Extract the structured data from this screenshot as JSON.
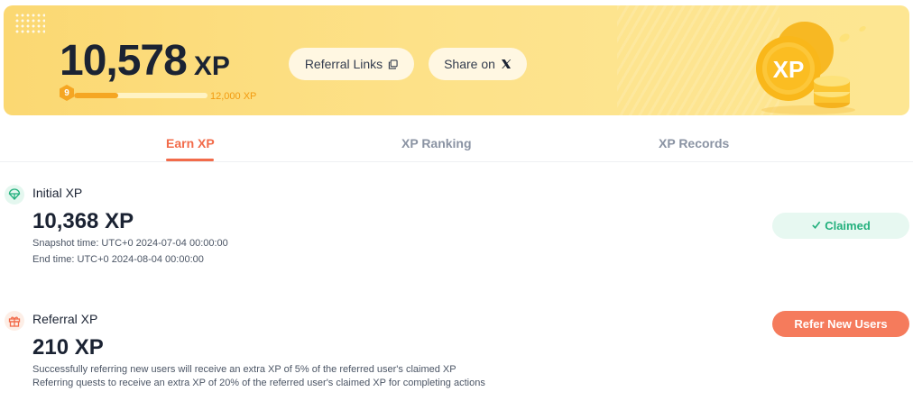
{
  "banner": {
    "total_xp": "10,578",
    "unit": "XP",
    "level": "9",
    "progress": 0.33,
    "goal": "12,000 XP",
    "referral_links_label": "Referral Links",
    "share_label": "Share on",
    "coin_label": "XP"
  },
  "tabs": [
    {
      "label": "Earn XP",
      "active": true
    },
    {
      "label": "XP Ranking",
      "active": false
    },
    {
      "label": "XP Records",
      "active": false
    }
  ],
  "initial": {
    "title": "Initial XP",
    "value": "10,368 XP",
    "snapshot": "Snapshot time: UTC+0 2024-07-04 00:00:00",
    "end": "End time: UTC+0 2024-08-04 00:00:00",
    "status_label": "Claimed"
  },
  "referral": {
    "title": "Referral XP",
    "value": "210 XP",
    "note1": "Successfully referring new users will receive an extra XP of 5% of the referred user's claimed XP",
    "note2": "Referring quests to receive an extra XP of 20% of the referred user's claimed XP for completing actions",
    "button_label": "Refer New Users"
  },
  "colors": {
    "accent": "#f26b4a",
    "banner": "#fde188",
    "success": "#23b07d",
    "progress": "#f5a623"
  },
  "icons": {
    "copy": "copy-icon",
    "x_logo": "x-logo-icon",
    "parachute": "parachute-icon",
    "gift": "gift-icon",
    "check": "check-icon"
  }
}
